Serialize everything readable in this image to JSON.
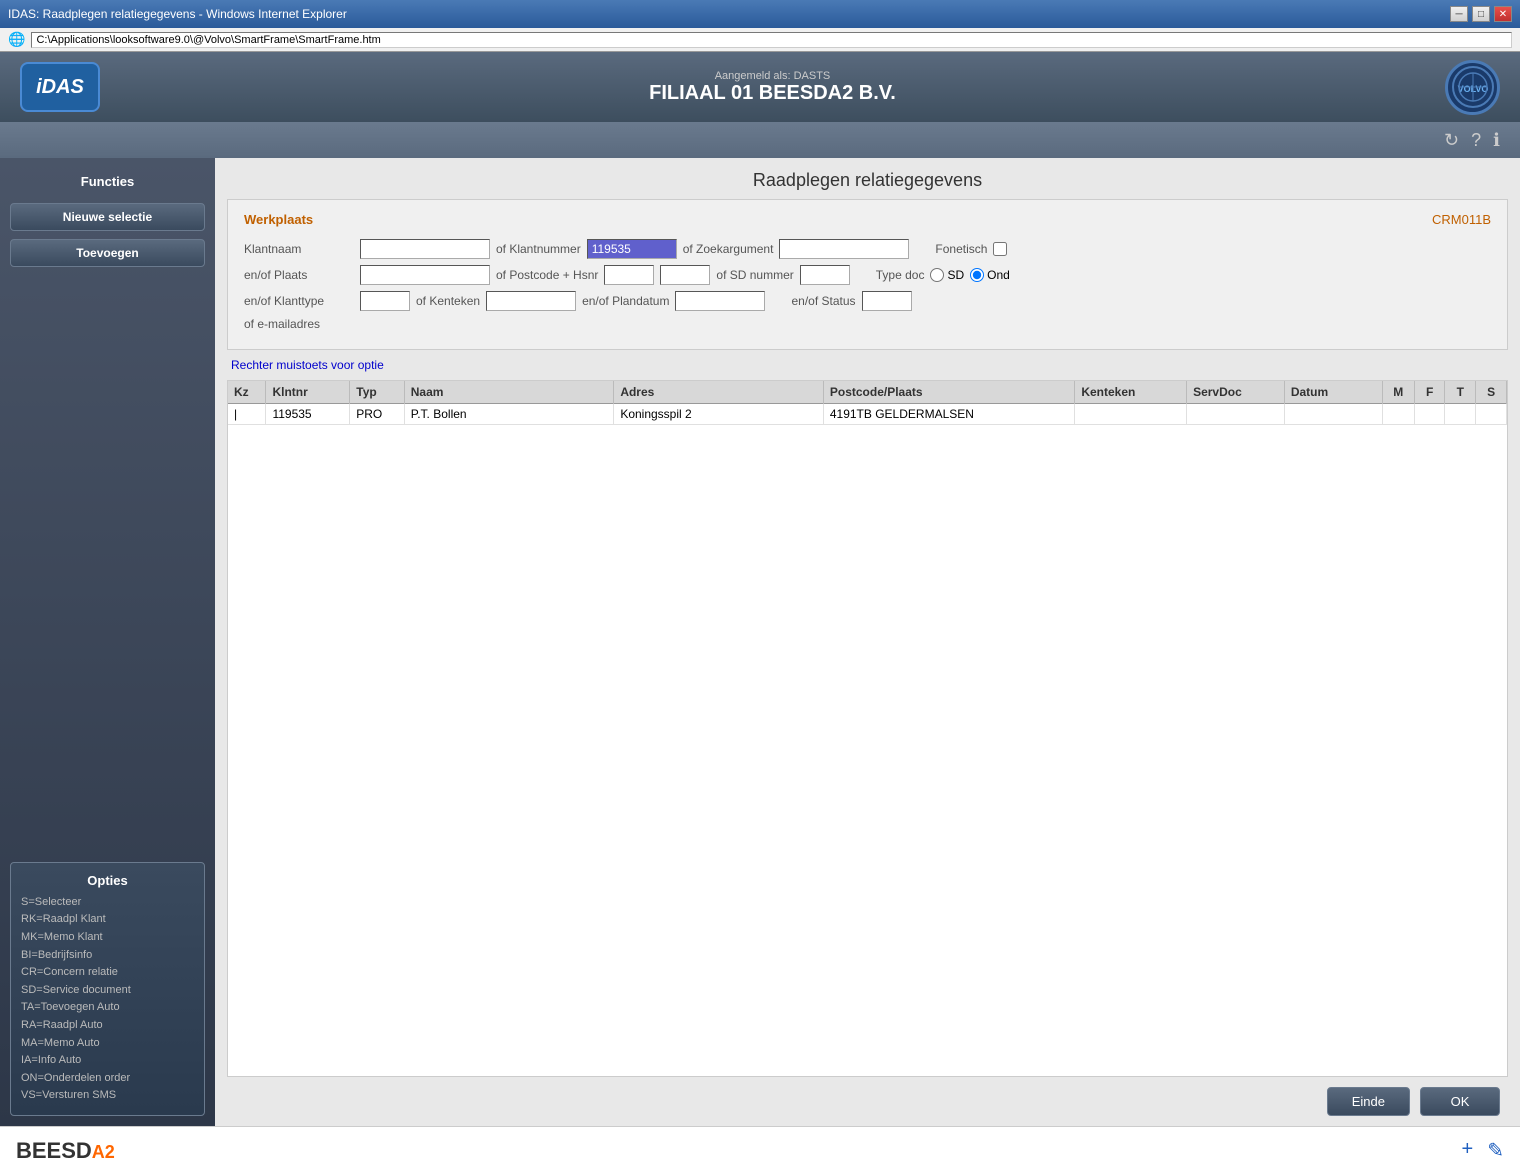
{
  "window": {
    "title": "IDAS: Raadplegen relatiegegevens - Windows Internet Explorer",
    "address": "C:\\Applications\\looksoftware9.0\\@Volvo\\SmartFrame\\SmartFrame.htm"
  },
  "header": {
    "logged_in_label": "Aangemeld als: DASTS",
    "company": "FILIAAL 01 BEESDA2 B.V.",
    "idas_logo": "iDAS",
    "volvo_logo": "VOLVO"
  },
  "sidebar": {
    "functies_title": "Functies",
    "nieuwe_selectie": "Nieuwe selectie",
    "toevoegen": "Toevoegen",
    "opties_title": "Opties",
    "opties_items": [
      "S=Selecteer",
      "RK=Raadpl Klant",
      "MK=Memo Klant",
      "BI=Bedrijfsinfo",
      "CR=Concern relatie",
      "SD=Service document",
      "TA=Toevoegen Auto",
      "RA=Raadpl Auto",
      "MA=Memo Auto",
      "IA=Info Auto",
      "ON=Onderdelen order",
      "VS=Versturen SMS"
    ]
  },
  "page": {
    "title": "Raadplegen relatiegegevens"
  },
  "form": {
    "werkplaats_label": "Werkplaats",
    "crm_code": "CRM011B",
    "klantnaam_label": "Klantnaam",
    "klantnaam_value": "",
    "of_klantnummer_label": "of Klantnummer",
    "klantnummer_value": "119535",
    "of_zoekargument_label": "of Zoekargument",
    "zoekargument_value": "",
    "fonetisch_label": "Fonetisch",
    "en_of_plaats_label": "en/of Plaats",
    "plaats_value": "",
    "of_postcode_hsnr_label": "of Postcode + Hsnr",
    "postcode_value": "",
    "hsnr_value": "",
    "of_sd_nummer_label": "of SD nummer",
    "sd_nummer_value": "",
    "type_doc_label": "Type doc",
    "type_sd_label": "SD",
    "type_ond_label": "Ond",
    "en_of_klanttype_label": "en/of Klanttype",
    "klanttype_value": "",
    "of_kenteken_label": "of Kenteken",
    "kenteken_value": "",
    "en_of_plandatum_label": "en/of Plandatum",
    "plandatum_value": "",
    "en_of_status_label": "en/of Status",
    "status_value": "",
    "of_emailadres_label": "of e-mailadres",
    "hint_text": "Rechter muistoets voor optie"
  },
  "table": {
    "columns": [
      "Kz",
      "Klntnr",
      "Typ",
      "Naam",
      "Adres",
      "Postcode/Plaats",
      "Kenteken",
      "ServDoc",
      "Datum",
      "M",
      "F",
      "T",
      "S"
    ],
    "rows": [
      {
        "kz": "|",
        "klntnr": "119535",
        "typ": "PRO",
        "naam": "P.T. Bollen",
        "adres": "Koningsspil 2",
        "postcode_plaats": "4191TB GELDERMALSEN",
        "kenteken": "",
        "servdoc": "",
        "datum": "",
        "m": "",
        "f": "",
        "t": "",
        "s": ""
      }
    ]
  },
  "footer": {
    "einde_label": "Einde",
    "ok_label": "OK"
  },
  "bottom": {
    "logo_text": "BEESD",
    "logo_a2": "A2",
    "plus_icon": "+",
    "edit_icon": "✎"
  }
}
